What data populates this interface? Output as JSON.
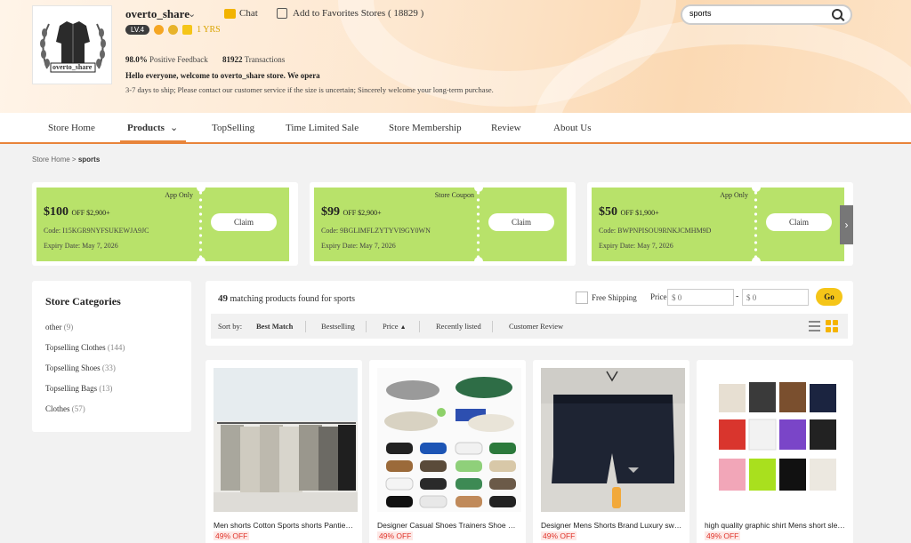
{
  "store": {
    "name": "overto_share",
    "logo_text": "overto_share",
    "chat_label": "Chat",
    "favorites_label": "Add to Favorites Stores ( 18829 )",
    "level": "LV.4",
    "years": "1 YRS",
    "positive_feedback_value": "98.0%",
    "positive_feedback_label": "Positive Feedback",
    "transactions_value": "81922",
    "transactions_label": "Transactions",
    "welcome": "Hello everyone, welcome to overto_share store. We opera",
    "ship_note": "3-7 days to ship; Please contact our customer service if the size is uncertain; Sincerely welcome your long-term purchase."
  },
  "search": {
    "value": "sports"
  },
  "nav": {
    "items": [
      "Store Home",
      "Products",
      "TopSelling",
      "Time Limited Sale",
      "Store Membership",
      "Review",
      "About Us"
    ]
  },
  "breadcrumb": {
    "home": "Store Home",
    "sep": ">",
    "current": "sports"
  },
  "coupons": [
    {
      "tag": "App Only",
      "amount": "$100",
      "condition": "OFF $2,900+",
      "code": "Code: I15KGR9NYFSUKEWJA9JC",
      "expiry": "Expiry Date: May 7, 2026",
      "claim": "Claim"
    },
    {
      "tag": "Store Coupon",
      "amount": "$99",
      "condition": "OFF $2,900+",
      "code": "Code: 9BGLIMFLZYTYVI9GY0WN",
      "expiry": "Expiry Date: May 7, 2026",
      "claim": "Claim"
    },
    {
      "tag": "App Only",
      "amount": "$50",
      "condition": "OFF $1,900+",
      "code": "Code: BWPNPISOU9RNKJCMHM9D",
      "expiry": "Expiry Date: May 7, 2026",
      "claim": "Claim"
    }
  ],
  "categories": {
    "title": "Store Categories",
    "items": [
      {
        "name": "other",
        "count": "(9)"
      },
      {
        "name": "Topselling Clothes",
        "count": "(144)"
      },
      {
        "name": "Topselling Shoes",
        "count": "(33)"
      },
      {
        "name": "Topselling Bags",
        "count": "(13)"
      },
      {
        "name": "Clothes",
        "count": "(57)"
      }
    ]
  },
  "results": {
    "count": "49",
    "text": "matching products found for sports",
    "free_shipping": "Free Shipping",
    "price_label": "Price",
    "price_min_placeholder": "$ 0",
    "price_max_placeholder": "$ 0",
    "dash": "-",
    "go": "Go",
    "sort_by": "Sort by:",
    "sorts": [
      "Best Match",
      "Bestselling",
      "Price",
      "Recently listed",
      "Customer Review"
    ],
    "price_arrow": "▲"
  },
  "products": [
    {
      "title": "Men shorts Cotton Sports shorts Panties Pants",
      "discount": "49% OFF"
    },
    {
      "title": "Designer Casual Shoes Trainers Shoe Sneakers",
      "discount": "49% OFF"
    },
    {
      "title": "Designer Mens Shorts Brand Luxury swim shorts",
      "discount": "49% OFF"
    },
    {
      "title": "high quality graphic shirt Mens short sleeve tee",
      "discount": "49% OFF"
    }
  ],
  "icons": {
    "chevron": "chevron-down-icon",
    "search": "search-icon",
    "chat": "chat-icon",
    "favorite": "store-favorite-icon",
    "arrow_left": "‹",
    "arrow_right": "›"
  },
  "colors": {
    "accent": "#e8843a",
    "coupon": "#b8e26a",
    "go": "#f5c518",
    "discount": "#e0342a"
  }
}
